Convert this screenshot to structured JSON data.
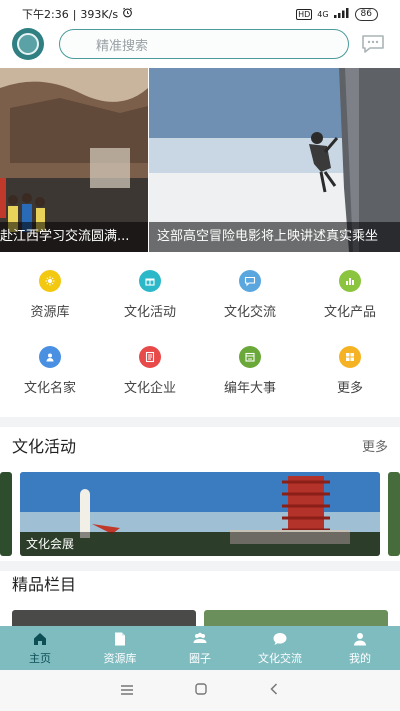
{
  "status_bar": {
    "time": "下午2:36",
    "speed": "393K/s",
    "network": "4G",
    "battery": "86",
    "alarm_icon": "alarm-icon",
    "signal_icon": "signal-icon"
  },
  "header": {
    "logo_icon": "org-logo-icon",
    "search_placeholder": "精准搜索",
    "message_icon": "chat-bubble-icon"
  },
  "banner": {
    "slides": [
      {
        "caption": "赴江西学习交流圆满..."
      },
      {
        "caption": "这部高空冒险电影将上映讲述真实乘坐"
      }
    ]
  },
  "categories": [
    {
      "label": "资源库",
      "icon": "folder-icon",
      "color": "#f2c811"
    },
    {
      "label": "文化活动",
      "icon": "gift-icon",
      "color": "#2bb8c9"
    },
    {
      "label": "文化交流",
      "icon": "chat-icon",
      "color": "#5aa7e0"
    },
    {
      "label": "文化产品",
      "icon": "bar-chart-icon",
      "color": "#8bc53f"
    },
    {
      "label": "文化名家",
      "icon": "person-icon",
      "color": "#4a90e2"
    },
    {
      "label": "文化企业",
      "icon": "document-icon",
      "color": "#e84a4a"
    },
    {
      "label": "编年大事",
      "icon": "calendar-icon",
      "color": "#6aa83a"
    },
    {
      "label": "更多",
      "icon": "grid-icon",
      "color": "#f5b323"
    }
  ],
  "activity_section": {
    "title": "文化活动",
    "more": "更多",
    "card_caption": "文化会展"
  },
  "featured_section": {
    "title": "精品栏目"
  },
  "tabs": [
    {
      "label": "主页",
      "icon": "home-icon",
      "active": true
    },
    {
      "label": "资源库",
      "icon": "file-icon",
      "active": false
    },
    {
      "label": "圈子",
      "icon": "group-icon",
      "active": false
    },
    {
      "label": "文化交流",
      "icon": "chat-icon",
      "active": false
    },
    {
      "label": "我的",
      "icon": "user-icon",
      "active": false
    }
  ],
  "system_nav": {
    "menu_icon": "menu-icon",
    "home_icon": "square-home-icon",
    "back_icon": "back-arrow-icon"
  }
}
